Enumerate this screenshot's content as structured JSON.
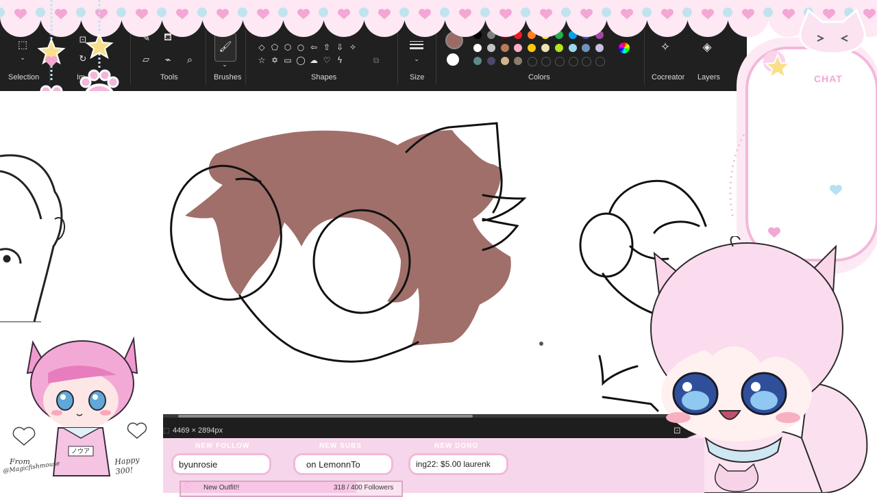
{
  "toolbar": {
    "groups": {
      "selection": "Selection",
      "image": "Im",
      "tools": "Tools",
      "brushes": "Brushes",
      "shapes": "Shapes",
      "size": "Size",
      "colors": "Colors",
      "cocreator": "Cocreator",
      "layers": "Layers"
    },
    "palette_row1": [
      "#000000",
      "#7f7f7f",
      "#880015",
      "#ed1c24",
      "#ff7f27",
      "#fff200",
      "#22b14c",
      "#00a2e8",
      "#3f48cc",
      "#a349a4"
    ],
    "palette_row2": [
      "#ffffff",
      "#c3c3c3",
      "#b97a57",
      "#ffaec9",
      "#ffc90e",
      "#efe4b0",
      "#b5e61d",
      "#99d9ea",
      "#7092be",
      "#c8bfe7"
    ],
    "palette_row3": [
      "#5f8a8b",
      "#4a4a6a",
      "#d2b48c",
      "#8b7d6b",
      "#2d2d2d",
      "#2d2d2d",
      "#2d2d2d",
      "#2d2d2d",
      "#2d2d2d",
      "#2d2d2d"
    ],
    "primary_color": "#9b6b66",
    "secondary_color": "#ffffff"
  },
  "canvas": {
    "fill_color": "#a06f6a"
  },
  "statusbar": {
    "dimensions": "4469 × 2894px"
  },
  "chat": {
    "label": "CHAT"
  },
  "overlay": {
    "artist_credit_line1": "From",
    "artist_credit_line2": "@Magicfishmouse",
    "greeting": "Happy 300!",
    "shirt_text": "ノウア"
  },
  "alerts": {
    "follow_title": "NEW FOLLOW",
    "follow_text": "byunrosie",
    "subs_title": "NEW SUBS",
    "subs_text": "on LemonnTo",
    "dono_title": "NEW DONO",
    "dono_text": "ing22: $5.00 laurenk",
    "goal_label": "New Outfit!!",
    "goal_value": "318 / 400 Followers",
    "goal_progress": 0.795
  }
}
